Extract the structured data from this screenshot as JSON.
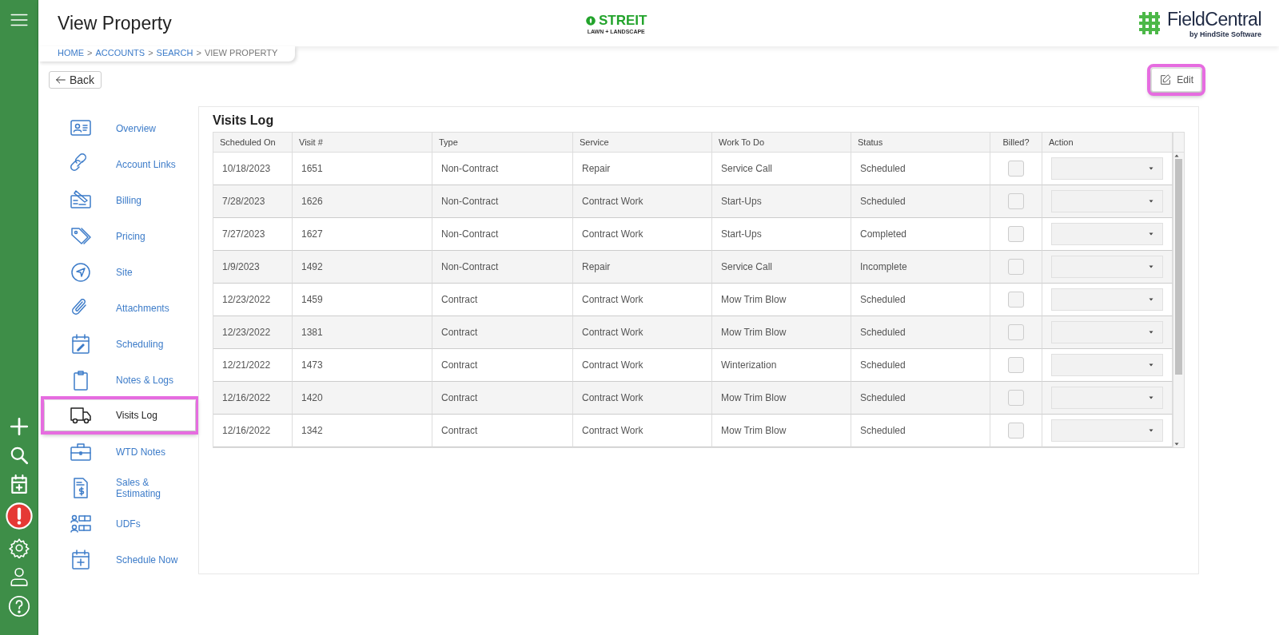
{
  "header": {
    "title": "View Property",
    "brand": {
      "name": "STREIT",
      "tagline": "LAWN + LANDSCAPE"
    },
    "product": {
      "name": "FieldCentral",
      "tagline": "by HindSite Software"
    }
  },
  "breadcrumb": [
    {
      "label": "HOME",
      "current": false
    },
    {
      "label": "ACCOUNTS",
      "current": false
    },
    {
      "label": "SEARCH",
      "current": false
    },
    {
      "label": "VIEW PROPERTY",
      "current": true
    }
  ],
  "breadcrumb_separator": ">",
  "back_button": {
    "label": "Back"
  },
  "edit_button": {
    "label": "Edit",
    "highlighted": true
  },
  "nav": [
    {
      "label": "Overview",
      "selected": false,
      "highlighted": false
    },
    {
      "label": "Account Links",
      "selected": false,
      "highlighted": false
    },
    {
      "label": "Billing",
      "selected": false,
      "highlighted": false
    },
    {
      "label": "Pricing",
      "selected": false,
      "highlighted": false
    },
    {
      "label": "Site",
      "selected": false,
      "highlighted": false
    },
    {
      "label": "Attachments",
      "selected": false,
      "highlighted": false
    },
    {
      "label": "Scheduling",
      "selected": false,
      "highlighted": false
    },
    {
      "label": "Notes & Logs",
      "selected": false,
      "highlighted": false
    },
    {
      "label": "Visits Log",
      "selected": true,
      "highlighted": true
    },
    {
      "label": "WTD Notes",
      "selected": false,
      "highlighted": false
    },
    {
      "label": "Sales & Estimating",
      "selected": false,
      "highlighted": false
    },
    {
      "label": "UDFs",
      "selected": false,
      "highlighted": false
    },
    {
      "label": "Schedule Now",
      "selected": false,
      "highlighted": false
    }
  ],
  "panel": {
    "title": "Visits Log"
  },
  "table": {
    "columns": [
      "Scheduled On",
      "Visit #",
      "Type",
      "Service",
      "Work To Do",
      "Status",
      "Billed?",
      "Action"
    ],
    "rows": [
      {
        "scheduled_on": "10/18/2023",
        "visit": "1651",
        "type": "Non-Contract",
        "service": "Repair",
        "work_to_do": "Service Call",
        "status": "Scheduled",
        "billed": false
      },
      {
        "scheduled_on": "7/28/2023",
        "visit": "1626",
        "type": "Non-Contract",
        "service": "Contract Work",
        "work_to_do": "Start-Ups",
        "status": "Scheduled",
        "billed": false
      },
      {
        "scheduled_on": "7/27/2023",
        "visit": "1627",
        "type": "Non-Contract",
        "service": "Contract Work",
        "work_to_do": "Start-Ups",
        "status": "Completed",
        "billed": false
      },
      {
        "scheduled_on": "1/9/2023",
        "visit": "1492",
        "type": "Non-Contract",
        "service": "Repair",
        "work_to_do": "Service Call",
        "status": "Incomplete",
        "billed": false
      },
      {
        "scheduled_on": "12/23/2022",
        "visit": "1459",
        "type": "Contract",
        "service": "Contract Work",
        "work_to_do": "Mow Trim Blow",
        "status": "Scheduled",
        "billed": false
      },
      {
        "scheduled_on": "12/23/2022",
        "visit": "1381",
        "type": "Contract",
        "service": "Contract Work",
        "work_to_do": "Mow Trim Blow",
        "status": "Scheduled",
        "billed": false
      },
      {
        "scheduled_on": "12/21/2022",
        "visit": "1473",
        "type": "Contract",
        "service": "Contract Work",
        "work_to_do": "Winterization",
        "status": "Scheduled",
        "billed": false
      },
      {
        "scheduled_on": "12/16/2022",
        "visit": "1420",
        "type": "Contract",
        "service": "Contract Work",
        "work_to_do": "Mow Trim Blow",
        "status": "Scheduled",
        "billed": false
      },
      {
        "scheduled_on": "12/16/2022",
        "visit": "1342",
        "type": "Contract",
        "service": "Contract Work",
        "work_to_do": "Mow Trim Blow",
        "status": "Scheduled",
        "billed": false
      }
    ]
  }
}
